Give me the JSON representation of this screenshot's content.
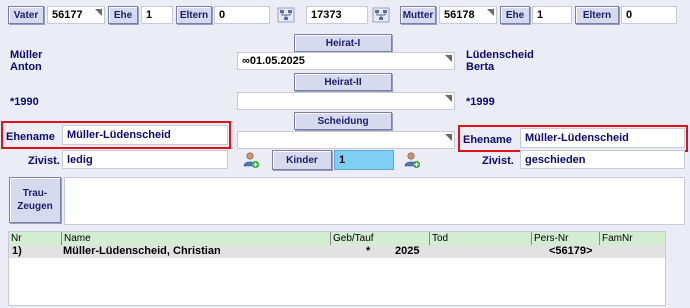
{
  "top_bar": {
    "vater_label": "Vater",
    "vater_value": "56177",
    "ehe_left_label": "Ehe",
    "ehe_left_value": "1",
    "eltern_left_label": "Eltern",
    "eltern_left_value": "0",
    "family_value": "17373",
    "mutter_label": "Mutter",
    "mutter_value": "56178",
    "ehe_right_label": "Ehe",
    "ehe_right_value": "1",
    "eltern_right_label": "Eltern",
    "eltern_right_value": "0"
  },
  "husband": {
    "surname": "Müller",
    "given": "Anton",
    "birth": "*1990",
    "ehename_label": "Ehename",
    "ehename": "Müller-Lüdenscheid",
    "zivist_label": "Zivist.",
    "zivist": "ledig"
  },
  "wife": {
    "surname": "Lüdenscheid",
    "given": "Berta",
    "birth": "*1999",
    "ehename_label": "Ehename",
    "ehename": "Müller-Lüdenscheid",
    "zivist_label": "Zivist.",
    "zivist": "geschieden"
  },
  "middle": {
    "heirat1_label": "Heirat-I",
    "heirat1_value": "∞01.05.2025",
    "heirat2_label": "Heirat-II",
    "heirat2_value": "",
    "scheidung_label": "Scheidung",
    "scheidung_value": "",
    "kinder_label": "Kinder",
    "kinder_value": "1"
  },
  "trauzeugen": {
    "label_line1": "Trau-",
    "label_line2": "Zeugen",
    "value": ""
  },
  "children_table": {
    "columns": [
      "Nr",
      "Name",
      "Geb/Tauf",
      "Tod",
      "Pers-Nr",
      "FamNr"
    ],
    "rows": [
      {
        "nr": "1)",
        "name": "Müller-Lüdenscheid, Christian",
        "birth_symbol": "*",
        "birth_year": "2025",
        "tod": "",
        "pers_nr": "<56179>",
        "fam_nr": ""
      }
    ]
  },
  "icons": {
    "tree": "family-tree-icon",
    "add_person": "add-person-icon"
  },
  "colors": {
    "highlight_red": "#e0111b",
    "header_green": "#d3edd0",
    "kinder_field_blue": "#7fcff5",
    "button_bg": "#d7d9ee"
  }
}
